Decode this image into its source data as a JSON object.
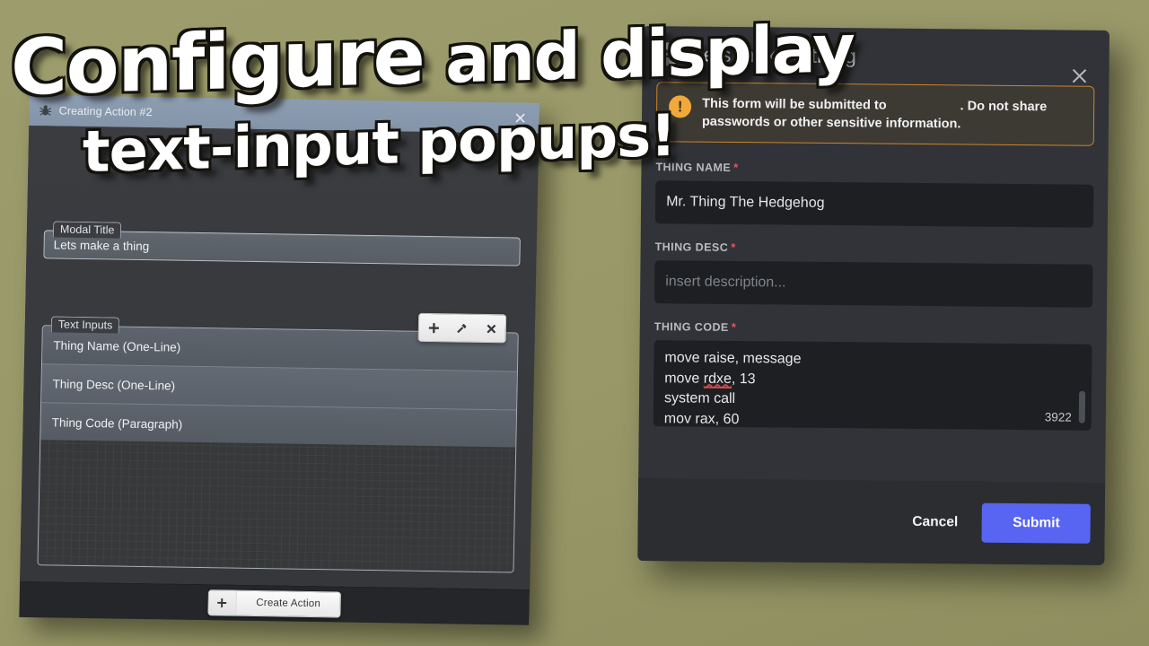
{
  "theme": {
    "background": "#9a9a69",
    "discord_blurple": "#5865f2",
    "warning_orange": "#c9862b",
    "warning_icon": "#f0a93b",
    "required_red": "#e8565a",
    "modal_bg": "#313338",
    "modal_footer_bg": "#2b2d31",
    "input_bg": "#1e1f22"
  },
  "overlay": {
    "line1_emphasis": "Configure",
    "line1_rest": " and display",
    "line2": "text-input popups!"
  },
  "left_window": {
    "titlebar": {
      "icon": "bug-icon",
      "title": "Creating Action #2",
      "close_icon": "close-icon"
    },
    "modal_title_group": {
      "legend": "Modal Title",
      "value": "Lets make a thing"
    },
    "text_inputs_group": {
      "legend": "Text Inputs",
      "toolbar": [
        {
          "icon": "plus-icon",
          "name": "add-text-input-button"
        },
        {
          "icon": "wrench-icon",
          "name": "edit-text-input-button"
        },
        {
          "icon": "close-icon",
          "name": "delete-text-input-button"
        }
      ],
      "rows": [
        "Thing Name (One-Line)",
        "Thing Desc (One-Line)",
        "Thing Code (Paragraph)"
      ]
    },
    "footer": {
      "create_action_icon": "plus-icon",
      "create_action_label": "Create Action"
    }
  },
  "discord_modal": {
    "header": {
      "avatar_icon": "discord-icon",
      "title": "Lets make a thing",
      "close_icon": "close-icon"
    },
    "warning": {
      "icon": "exclamation-icon",
      "text_before": "This form will be submitted to",
      "app_name": "",
      "text_after": ". Do not share passwords or other sensitive information."
    },
    "fields": [
      {
        "label": "THING NAME",
        "required": true,
        "value": "Mr. Thing The Hedgehog",
        "placeholder": "",
        "type": "short"
      },
      {
        "label": "THING DESC",
        "required": true,
        "value": "",
        "placeholder": "insert description...",
        "type": "short"
      },
      {
        "label": "THING CODE",
        "required": true,
        "type": "paragraph",
        "lines": [
          "move raise, message",
          "move rdxe, 13",
          "system call",
          "mov rax, 60"
        ],
        "misspelled_word": "rdxe",
        "char_count": "3922"
      }
    ],
    "footer": {
      "cancel_label": "Cancel",
      "submit_label": "Submit"
    }
  }
}
